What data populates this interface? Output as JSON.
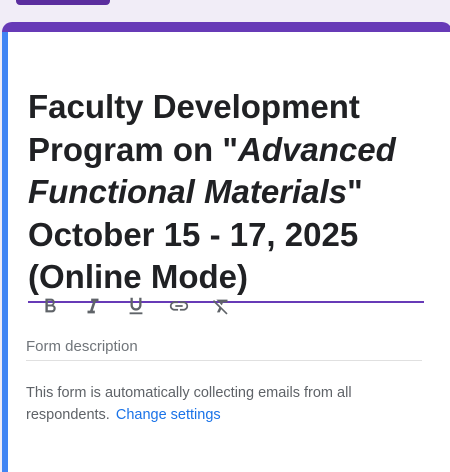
{
  "form": {
    "title_line1": "Faculty Development",
    "title_line2_prefix": "Program on \"",
    "title_line2_italic": "Advanced",
    "title_line3_italic": "Functional Materials",
    "title_line3_suffix": "\"",
    "title_line4": "October 15 - 17, 2025",
    "title_line5": "(Online Mode)",
    "description_placeholder": "Form description",
    "notice_text": "This form is automatically collecting emails from all respondents.",
    "notice_link": "Change settings"
  },
  "toolbar": {
    "items": [
      "bold-icon",
      "italic-icon",
      "underline-icon",
      "link-icon",
      "clear-formatting-icon"
    ]
  },
  "colors": {
    "accent": "#673ab7",
    "focus_bar": "#4285f4",
    "link": "#1a73e8"
  }
}
